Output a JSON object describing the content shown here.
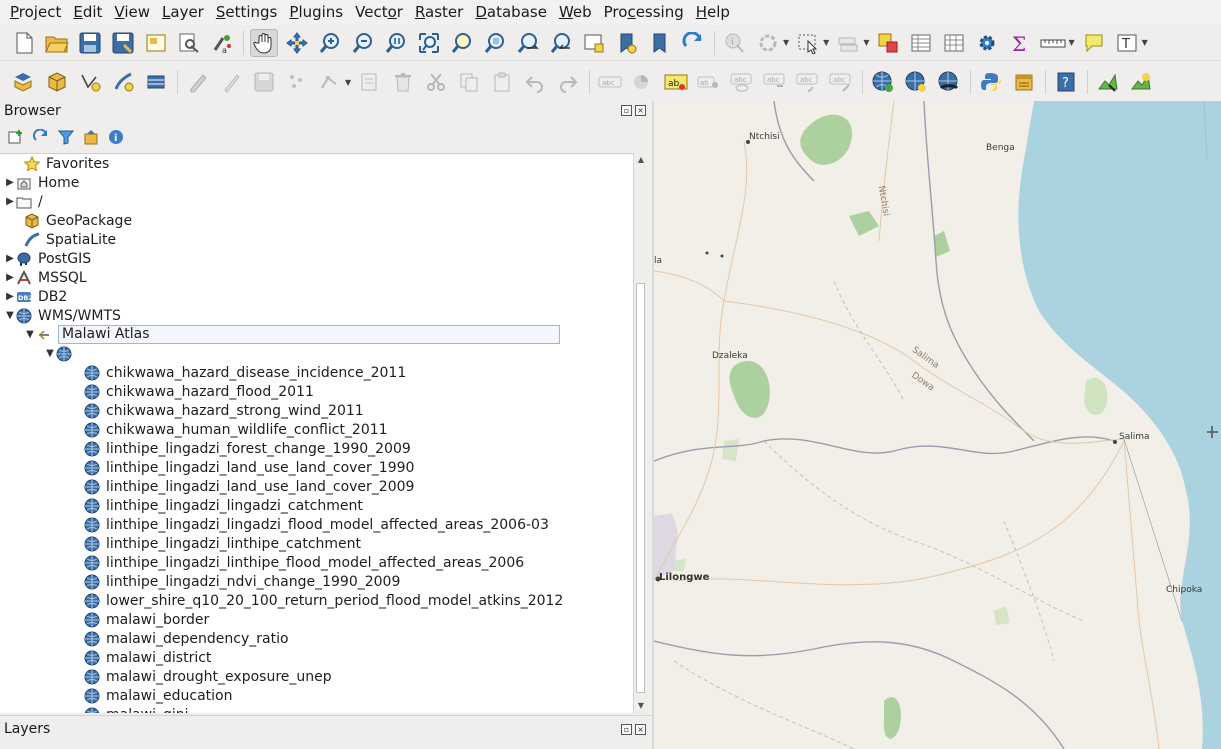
{
  "menu": [
    {
      "pre": "",
      "u": "P",
      "post": "roject"
    },
    {
      "pre": "",
      "u": "E",
      "post": "dit"
    },
    {
      "pre": "",
      "u": "V",
      "post": "iew"
    },
    {
      "pre": "",
      "u": "L",
      "post": "ayer"
    },
    {
      "pre": "",
      "u": "S",
      "post": "ettings"
    },
    {
      "pre": "",
      "u": "P",
      "post": "lugins"
    },
    {
      "pre": "Vect",
      "u": "o",
      "post": "r"
    },
    {
      "pre": "",
      "u": "R",
      "post": "aster"
    },
    {
      "pre": "",
      "u": "D",
      "post": "atabase"
    },
    {
      "pre": "",
      "u": "W",
      "post": "eb"
    },
    {
      "pre": "Pro",
      "u": "c",
      "post": "essing"
    },
    {
      "pre": "",
      "u": "H",
      "post": "elp"
    }
  ],
  "toolbar2_texts": {
    "abc": "abc",
    "ab": "ab"
  },
  "browser": {
    "title": "Browser",
    "tree": {
      "favorites": "Favorites",
      "home": "Home",
      "root": "/",
      "geopackage": "GeoPackage",
      "spatialite": "SpatiaLite",
      "postgis": "PostGIS",
      "mssql": "MSSQL",
      "db2": "DB2",
      "db2_icon_text": "DB2",
      "wms": "WMS/WMTS",
      "connection": "Malawi Atlas",
      "layers": [
        "chikwawa_hazard_disease_incidence_2011",
        "chikwawa_hazard_flood_2011",
        "chikwawa_hazard_strong_wind_2011",
        "chikwawa_human_wildlife_conflict_2011",
        "linthipe_lingadzi_forest_change_1990_2009",
        "linthipe_lingadzi_land_use_land_cover_1990",
        "linthipe_lingadzi_land_use_land_cover_2009",
        "linthipe_lingadzi_lingadzi_catchment",
        "linthipe_lingadzi_lingadzi_flood_model_affected_areas_2006-03",
        "linthipe_lingadzi_linthipe_catchment",
        "linthipe_lingadzi_linthipe_flood_model_affected_areas_2006",
        "linthipe_lingadzi_ndvi_change_1990_2009",
        "lower_shire_q10_20_100_return_period_flood_model_atkins_2012",
        "malawi_border",
        "malawi_dependency_ratio",
        "malawi_district",
        "malawi_drought_exposure_unep",
        "malawi_education",
        "malawi_gini"
      ]
    }
  },
  "layers_panel": {
    "title": "Layers"
  },
  "map": {
    "places": {
      "ntchisi": "Ntchisi",
      "benga": "Benga",
      "ntchisi_road": "Ntchisi",
      "la": "la",
      "dzaleka": "Dzaleka",
      "salima_road": "Salima",
      "dowa_road": "Dowa",
      "salima": "Salima",
      "lilongwe": "Lilongwe",
      "chipoka": "Chipoka"
    },
    "colors": {
      "land": "#f2efe8",
      "water": "#aad3df",
      "forest": "#add19e",
      "border": "#9e9cab",
      "road": "#e8c5a2",
      "urban": "#ddd8e2"
    }
  },
  "colors": {
    "panel_bg": "#efeeed",
    "selection_border": "#9fb6cc",
    "globe_blue": "#3a6ea5"
  }
}
